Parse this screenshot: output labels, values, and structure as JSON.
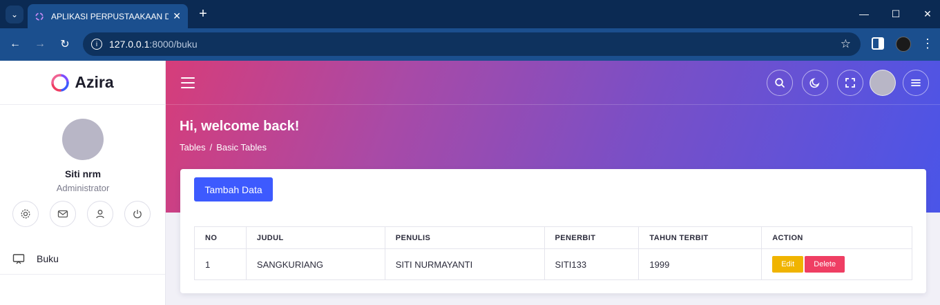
{
  "browser": {
    "tab_title": "APLIKASI PERPUSTAAKAAN DIG",
    "url_host": "127.0.0.1",
    "url_path": ":8000/buku"
  },
  "app": {
    "logo_text": "Azira"
  },
  "user": {
    "name": "Siti nrm",
    "role": "Administrator"
  },
  "sidebar": {
    "items": [
      {
        "label": "Buku",
        "icon": "monitor-icon"
      }
    ]
  },
  "header": {
    "welcome": "Hi, welcome back!",
    "breadcrumb": [
      "Tables",
      "Basic Tables"
    ],
    "breadcrumb_sep": "/"
  },
  "main": {
    "add_button": "Tambah Data",
    "table": {
      "columns": [
        "NO",
        "JUDUL",
        "PENULIS",
        "PENERBIT",
        "TAHUN TERBIT",
        "ACTION"
      ],
      "rows": [
        {
          "no": "1",
          "judul": "SANGKURIANG",
          "penulis": "SITI NURMAYANTI",
          "penerbit": "SITI133",
          "tahun": "1999",
          "edit": "Edit",
          "delete": "Delete"
        }
      ]
    }
  },
  "colors": {
    "primary": "#3d5afe",
    "edit": "#f0b400",
    "delete": "#ef3e63"
  }
}
